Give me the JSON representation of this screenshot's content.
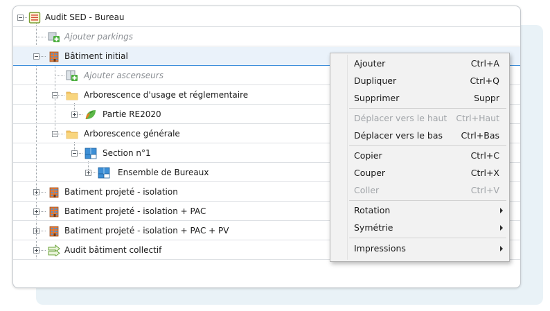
{
  "tree": {
    "root": "Audit SED - Bureau",
    "add_parking": "Ajouter parkings",
    "bat_initial": "Bâtiment initial",
    "add_elevators": "Ajouter ascenseurs",
    "arbo_usage": "Arborescence d'usage et réglementaire",
    "partie_re2020": "Partie RE2020",
    "arbo_generale": "Arborescence générale",
    "section": "Section n°1",
    "ensemble": "Ensemble de Bureaux",
    "projete_iso": "Batiment projeté - isolation",
    "projete_iso_pac": "Batiment projeté - isolation + PAC",
    "projete_iso_pac_pv": "Batiment projeté - isolation + PAC + PV",
    "audit_collectif": "Audit bâtiment collectif"
  },
  "menu": {
    "ajouter": {
      "label": "Ajouter",
      "shortcut": "Ctrl+A"
    },
    "dupliquer": {
      "label": "Dupliquer",
      "shortcut": "Ctrl+Q"
    },
    "supprimer": {
      "label": "Supprimer",
      "shortcut": "Suppr"
    },
    "deplacer_haut": {
      "label": "Déplacer vers le haut",
      "shortcut": "Ctrl+Haut"
    },
    "deplacer_bas": {
      "label": "Déplacer vers le bas",
      "shortcut": "Ctrl+Bas"
    },
    "copier": {
      "label": "Copier",
      "shortcut": "Ctrl+C"
    },
    "couper": {
      "label": "Couper",
      "shortcut": "Ctrl+X"
    },
    "coller": {
      "label": "Coller",
      "shortcut": "Ctrl+V"
    },
    "rotation": {
      "label": "Rotation"
    },
    "symetrie": {
      "label": "Symétrie"
    },
    "impressions": {
      "label": "Impressions"
    }
  },
  "icons": {
    "root": "audit-document-icon",
    "parking": "add-parking-icon",
    "building": "building-icon",
    "elevator": "add-elevator-icon",
    "folder": "folder-icon",
    "leaf": "re2020-leaf-icon",
    "section": "section-blocks-icon",
    "collective": "green-arrow-icon"
  },
  "colors": {
    "selection_line": "#3b8edb",
    "selection_bg": "#eaf2fa",
    "folder": "#f5c869",
    "disabled_text": "#a0a4a8"
  }
}
